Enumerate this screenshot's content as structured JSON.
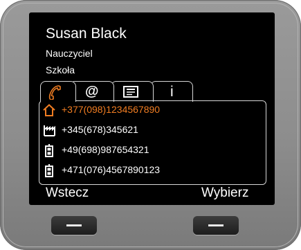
{
  "contact": {
    "name": "Susan Black",
    "title": "Nauczyciel",
    "organization": "Szkoła"
  },
  "tabs": [
    {
      "icon": "phone-handset-icon",
      "active": true
    },
    {
      "label": "@",
      "icon": "email-at-icon",
      "active": false
    },
    {
      "icon": "business-card-icon",
      "active": false
    },
    {
      "label": "i",
      "icon": "info-icon",
      "active": false
    }
  ],
  "numbers": [
    {
      "type": "home-icon",
      "number": "+377(098)1234567890",
      "selected": true
    },
    {
      "type": "office-building-icon",
      "number": "+345(678)345621",
      "selected": false
    },
    {
      "type": "mobile-phone-icon",
      "number": "+49(698)987654321",
      "selected": false
    },
    {
      "type": "mobile-phone-icon",
      "number": "+471(076)4567890123",
      "selected": false
    }
  ],
  "softkeys": {
    "left": "Wstecz",
    "right": "Wybierz"
  },
  "colors": {
    "accent": "#f07d22",
    "screen_bg": "#000000",
    "text": "#ffffff",
    "device_body": "#8d8d8d"
  }
}
